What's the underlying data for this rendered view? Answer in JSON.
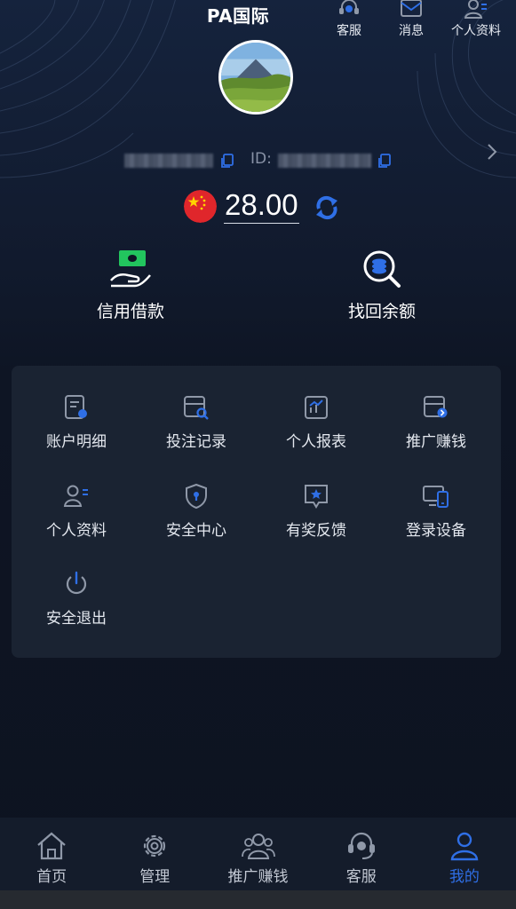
{
  "app": {
    "title": "PA国际"
  },
  "header": {
    "actions": [
      {
        "label": "客服",
        "icon": "headset-icon"
      },
      {
        "label": "消息",
        "icon": "envelope-icon"
      },
      {
        "label": "个人资料",
        "icon": "user-card-icon"
      }
    ]
  },
  "profile": {
    "id_label": "ID:",
    "balance": "28.00",
    "currency_flag": "china-flag-icon"
  },
  "quick_actions": [
    {
      "label": "信用借款",
      "icon": "cash-hand-icon"
    },
    {
      "label": "找回余额",
      "icon": "coin-search-icon"
    }
  ],
  "menu": [
    {
      "label": "账户明细",
      "icon": "account-detail-icon"
    },
    {
      "label": "投注记录",
      "icon": "bet-record-icon"
    },
    {
      "label": "个人报表",
      "icon": "report-icon"
    },
    {
      "label": "推广赚钱",
      "icon": "promote-icon"
    },
    {
      "label": "个人资料",
      "icon": "profile-icon"
    },
    {
      "label": "安全中心",
      "icon": "security-shield-icon"
    },
    {
      "label": "有奖反馈",
      "icon": "feedback-star-icon"
    },
    {
      "label": "登录设备",
      "icon": "devices-icon"
    },
    {
      "label": "安全退出",
      "icon": "power-icon"
    }
  ],
  "bottom_nav": [
    {
      "label": "首页",
      "icon": "home-icon"
    },
    {
      "label": "管理",
      "icon": "gear-icon"
    },
    {
      "label": "推广赚钱",
      "icon": "group-icon"
    },
    {
      "label": "客服",
      "icon": "headset-icon"
    },
    {
      "label": "我的",
      "icon": "user-icon",
      "active": true
    }
  ],
  "colors": {
    "accent": "#2f6fe6",
    "icon_gray": "#8f98a8",
    "panel": "#1a2332",
    "background": "#0f1522",
    "quick_icon_green": "#22c55e"
  }
}
